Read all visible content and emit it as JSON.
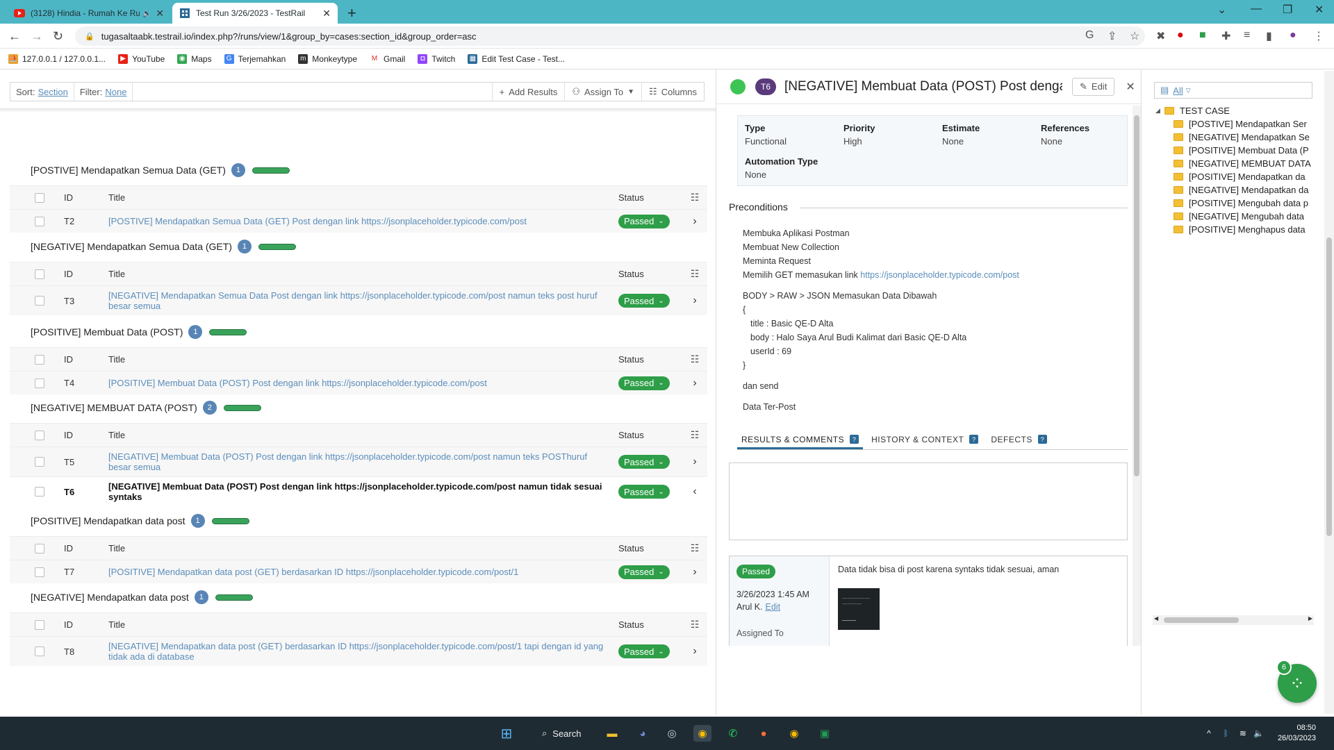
{
  "browser": {
    "tabs": [
      {
        "label": "(3128) Hindia - Rumah Ke Ru",
        "active": false,
        "icon": "youtube-icon"
      },
      {
        "label": "Test Run 3/26/2023 - TestRail",
        "active": true,
        "icon": "testrail-icon"
      }
    ],
    "url": "tugasaltaabk.testrail.io/index.php?/runs/view/1&group_by=cases:section_id&group_order=asc",
    "bookmarks": [
      "127.0.0.1 / 127.0.0.1...",
      "YouTube",
      "Maps",
      "Terjemahkan",
      "Monkeytype",
      "Gmail",
      "Twitch",
      "Edit Test Case - Test..."
    ]
  },
  "toolbar": {
    "sort_label": "Sort:",
    "sort_value": "Section",
    "filter_label": "Filter:",
    "filter_value": "None",
    "add_results": "Add Results",
    "assign_to": "Assign To",
    "columns": "Columns"
  },
  "columns": {
    "id": "ID",
    "title": "Title",
    "status": "Status"
  },
  "sections": [
    {
      "name": "[POSTIVE] Mendapatkan Semua Data (GET)",
      "count": "1",
      "rows": [
        {
          "id": "T2",
          "title": "[POSTIVE] Mendapatkan Semua Data (GET) Post dengan link https://jsonplaceholder.typicode.com/post",
          "status": "Passed"
        }
      ]
    },
    {
      "name": "[NEGATIVE] Mendapatkan Semua Data (GET)",
      "count": "1",
      "rows": [
        {
          "id": "T3",
          "title": "[NEGATIVE] Mendapatkan Semua Data Post dengan link https://jsonplaceholder.typicode.com/post namun teks post huruf besar semua",
          "status": "Passed"
        }
      ]
    },
    {
      "name": "[POSITIVE] Membuat Data (POST)",
      "count": "1",
      "rows": [
        {
          "id": "T4",
          "title": "[POSITIVE] Membuat Data (POST) Post dengan link https://jsonplaceholder.typicode.com/post",
          "status": "Passed"
        }
      ]
    },
    {
      "name": "[NEGATIVE] MEMBUAT DATA (POST)",
      "count": "2",
      "rows": [
        {
          "id": "T5",
          "title": "[NEGATIVE] Membuat Data (POST) Post dengan link https://jsonplaceholder.typicode.com/post namun teks POSThuruf besar semua",
          "status": "Passed"
        },
        {
          "id": "T6",
          "title": "[NEGATIVE] Membuat Data (POST) Post dengan link https://jsonplaceholder.typicode.com/post namun tidak sesuai syntaks",
          "status": "Passed",
          "selected": true
        }
      ]
    },
    {
      "name": "[POSITIVE] Mendapatkan data post",
      "count": "1",
      "rows": [
        {
          "id": "T7",
          "title": "[POSITIVE] Mendapatkan data post (GET) berdasarkan ID https://jsonplaceholder.typicode.com/post/1",
          "status": "Passed"
        }
      ]
    },
    {
      "name": "[NEGATIVE] Mendapatkan data post",
      "count": "1",
      "rows": [
        {
          "id": "T8",
          "title": "[NEGATIVE] Mendapatkan data post (GET) berdasarkan ID https://jsonplaceholder.typicode.com/post/1 tapi dengan id yang tidak ada di database",
          "status": "Passed"
        }
      ]
    }
  ],
  "detail": {
    "id": "T6",
    "title": "[NEGATIVE] Membuat Data (POST) Post denga...",
    "edit": "Edit",
    "props": {
      "type_k": "Type",
      "type_v": "Functional",
      "priority_k": "Priority",
      "priority_v": "High",
      "estimate_k": "Estimate",
      "estimate_v": "None",
      "refs_k": "References",
      "refs_v": "None",
      "auto_k": "Automation Type",
      "auto_v": "None"
    },
    "preconditions_title": "Preconditions",
    "pre": {
      "l1": "Membuka Aplikasi Postman",
      "l2": "Membuat New Collection",
      "l3": "Meminta Request",
      "l4": "Memilih GET memasukan link",
      "l4_link": "https://jsonplaceholder.typicode.com/post",
      "l5": "BODY > RAW > JSON Memasukan Data Dibawah",
      "l6": "{",
      "l7": "title : Basic QE-D Alta",
      "l8": "body : Halo Saya Arul Budi Kalimat dari Basic QE-D Alta",
      "l9": "userId : 69",
      "l10": "}",
      "l11": "dan send",
      "l12": "Data Ter-Post"
    },
    "tabs": [
      "RESULTS & COMMENTS",
      "HISTORY & CONTEXT",
      "DEFECTS"
    ],
    "tab_help": "?",
    "result": {
      "status": "Passed",
      "date": "3/26/2023 1:45 AM",
      "by": "Arul K.",
      "edit": "Edit",
      "assigned": "Assigned To",
      "comment": "Data tidak bisa di post karena syntaks tidak sesuai, aman"
    }
  },
  "tree": {
    "filter_value": "All",
    "root": "TEST CASE",
    "items": [
      "[POSTIVE] Mendapatkan Ser",
      "[NEGATIVE] Mendapatkan Se",
      "[POSITIVE] Membuat Data (P",
      "[NEGATIVE] MEMBUAT DATA",
      "[POSITIVE] Mendapatkan da",
      "[NEGATIVE] Mendapatkan da",
      "[POSITIVE] Mengubah data p",
      "[NEGATIVE] Mengubah data",
      "[POSITIVE] Menghapus data"
    ]
  },
  "fab_badge": "6",
  "taskbar": {
    "search": "Search",
    "time": "08:50",
    "date": "26/03/2023"
  },
  "colors": {
    "passed": "#2e9e48",
    "link": "#5b8dba",
    "chrome": "#4db6c5",
    "count_badge": "#5885b5"
  }
}
